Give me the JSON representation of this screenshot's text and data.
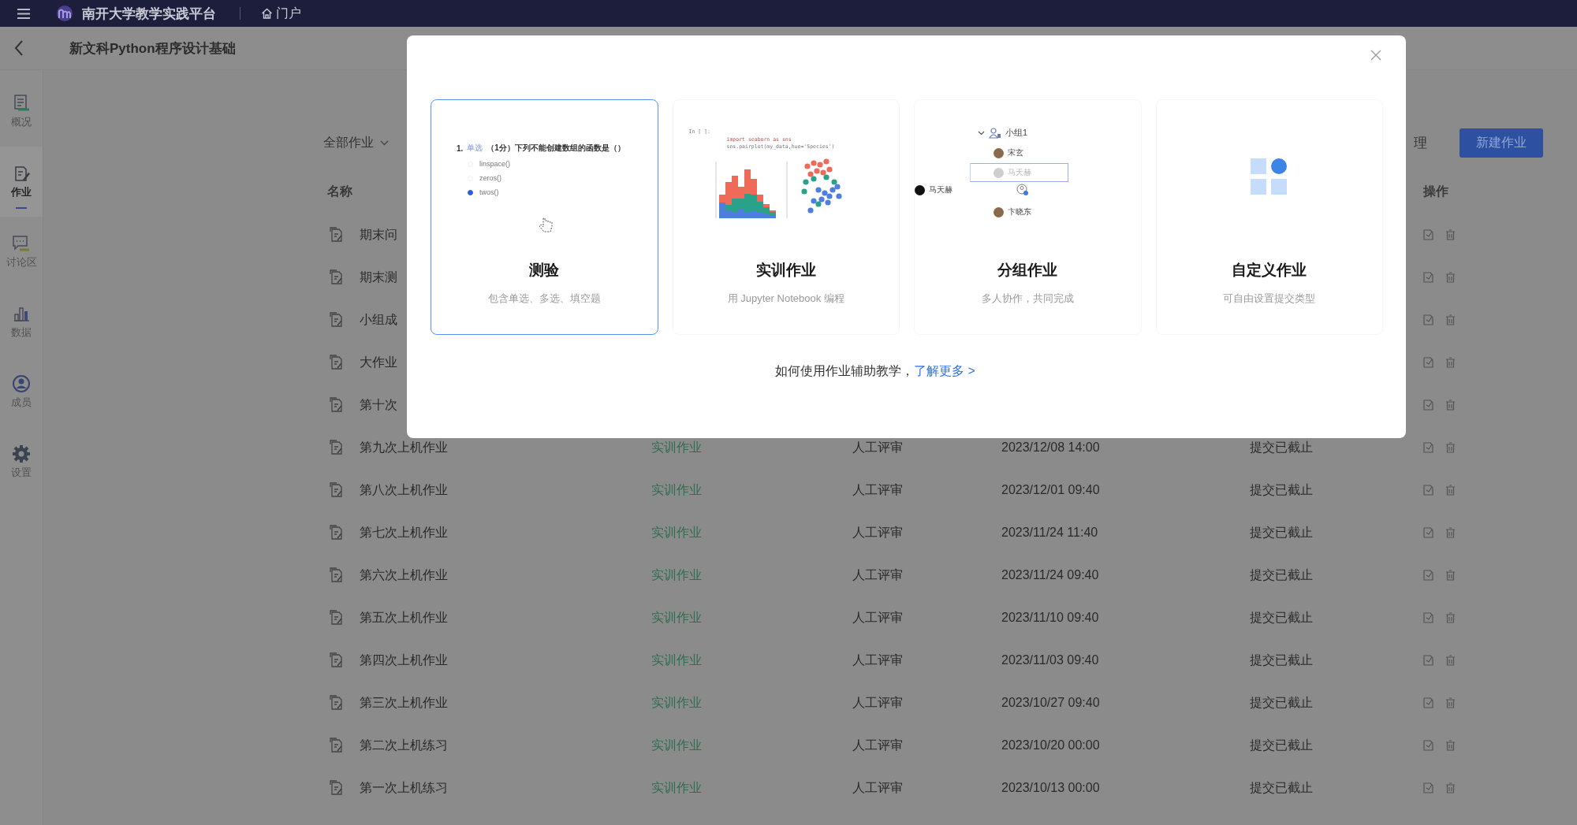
{
  "topbar": {
    "title": "南开大学教学实践平台",
    "portal": "门户"
  },
  "course_title": "新文科Python程序设计基础",
  "sidebar": {
    "items": [
      {
        "label": "概况",
        "selected": false
      },
      {
        "label": "作业",
        "selected": true
      },
      {
        "label": "讨论区",
        "selected": false
      },
      {
        "label": "数据",
        "selected": false
      },
      {
        "label": "成员",
        "selected": false
      },
      {
        "label": "设置",
        "selected": false
      }
    ]
  },
  "toolbar": {
    "filter": "全部作业",
    "manage": "理",
    "new_button": "新建作业"
  },
  "table": {
    "columns": [
      "名称",
      "操作"
    ],
    "rows": [
      {
        "name": "期末问"
      },
      {
        "name": "期末测"
      },
      {
        "name": "小组成"
      },
      {
        "name": "大作业"
      },
      {
        "name": "第十次"
      },
      {
        "name": "第九次上机作业",
        "type": "实训作业",
        "review": "人工评审",
        "deadline": "2023/12/08 14:00",
        "status": "提交已截止"
      },
      {
        "name": "第八次上机作业",
        "type": "实训作业",
        "review": "人工评审",
        "deadline": "2023/12/01 09:40",
        "status": "提交已截止"
      },
      {
        "name": "第七次上机作业",
        "type": "实训作业",
        "review": "人工评审",
        "deadline": "2023/11/24 11:40",
        "status": "提交已截止"
      },
      {
        "name": "第六次上机作业",
        "type": "实训作业",
        "review": "人工评审",
        "deadline": "2023/11/24 09:40",
        "status": "提交已截止"
      },
      {
        "name": "第五次上机作业",
        "type": "实训作业",
        "review": "人工评审",
        "deadline": "2023/11/10 09:40",
        "status": "提交已截止"
      },
      {
        "name": "第四次上机作业",
        "type": "实训作业",
        "review": "人工评审",
        "deadline": "2023/11/03 09:40",
        "status": "提交已截止"
      },
      {
        "name": "第三次上机作业",
        "type": "实训作业",
        "review": "人工评审",
        "deadline": "2023/10/27 09:40",
        "status": "提交已截止"
      },
      {
        "name": "第二次上机练习",
        "type": "实训作业",
        "review": "人工评审",
        "deadline": "2023/10/20 00:00",
        "status": "提交已截止"
      },
      {
        "name": "第一次上机练习",
        "type": "实训作业",
        "review": "人工评审",
        "deadline": "2023/10/13 00:00",
        "status": "提交已截止"
      }
    ]
  },
  "dialog": {
    "cards": [
      {
        "kind": "quiz",
        "title": "测验",
        "subtitle": "包含单选、多选、填空题",
        "selected": true,
        "preview": {
          "number": "1.",
          "tag": "单选",
          "question": "（1分）下列不能创建数组的函数是（）",
          "options": [
            {
              "text": "linspace()",
              "selected": false
            },
            {
              "text": "zeros()",
              "selected": false
            },
            {
              "text": "twos()",
              "selected": true
            }
          ]
        }
      },
      {
        "kind": "notebook",
        "title": "实训作业",
        "subtitle": "用 Jupyter Notebook 编程",
        "selected": false,
        "preview": {
          "prompt": "In [ ]:",
          "code": [
            "import seaborn as sns",
            "sns.pairplot(my_data,hue='Species')"
          ]
        }
      },
      {
        "kind": "group",
        "title": "分组作业",
        "subtitle": "多人协作，共同完成",
        "selected": false,
        "preview": {
          "group": "小组1",
          "members": [
            {
              "name": "宋玄",
              "kind": "member"
            },
            {
              "name": "马天赫",
              "kind": "placeholder"
            },
            {
              "name": "马天赫",
              "kind": "dragged"
            },
            {
              "name": "卞晓东",
              "kind": "member"
            }
          ]
        }
      },
      {
        "kind": "custom",
        "title": "自定义作业",
        "subtitle": "可自由设置提交类型",
        "selected": false
      }
    ],
    "footer": {
      "text": "如何使用作业辅助教学，",
      "link": "了解更多 >"
    }
  }
}
